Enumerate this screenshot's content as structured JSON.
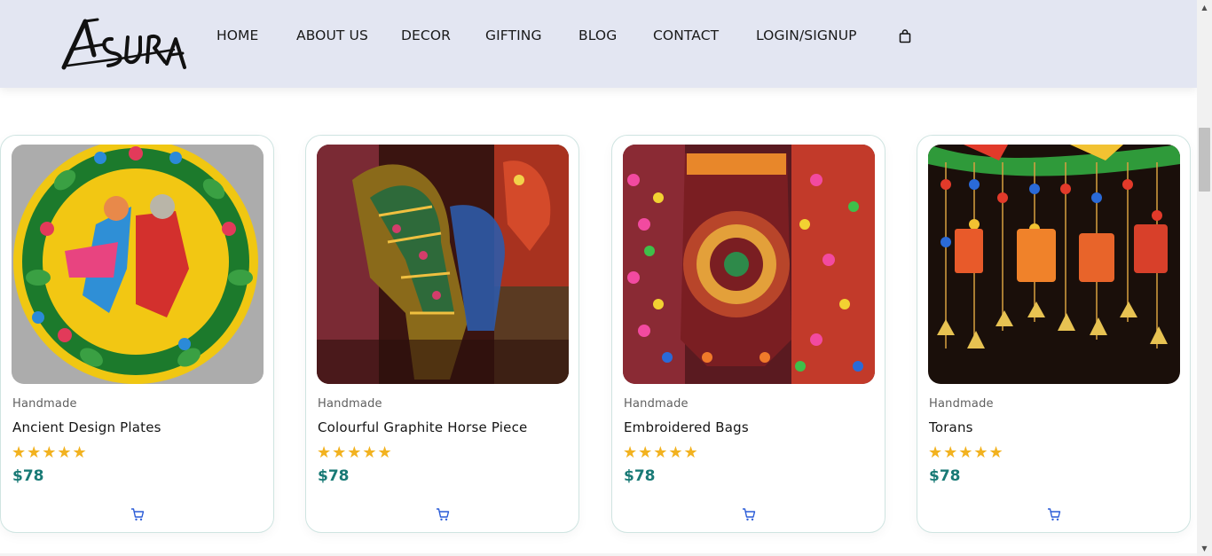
{
  "brand": {
    "logo_text": "Asura"
  },
  "nav": {
    "items": [
      "HOME",
      "ABOUT US",
      "DECOR",
      "GIFTING",
      "BLOG",
      "CONTACT",
      "LOGIN/SIGNUP"
    ],
    "cart_icon": "shopping-bag-icon"
  },
  "colors": {
    "header_bg": "#e3e6f2",
    "price": "#197a76",
    "star": "#f2b21f",
    "card_border": "#cfe4e1",
    "cart_icon": "#2a5bd7"
  },
  "products": [
    {
      "category": "Handmade",
      "title": "Ancient Design Plates",
      "rating": "★★★★★",
      "price": "$78",
      "image_icon": "painted-plate-image",
      "cart_icon": "cart-icon"
    },
    {
      "category": "Handmade",
      "title": "Colourful Graphite Horse Piece",
      "rating": "★★★★★",
      "price": "$78",
      "image_icon": "painted-horse-image",
      "cart_icon": "cart-icon"
    },
    {
      "category": "Handmade",
      "title": "Embroidered Bags",
      "rating": "★★★★★",
      "price": "$78",
      "image_icon": "embroidered-bag-image",
      "cart_icon": "cart-icon"
    },
    {
      "category": "Handmade",
      "title": "Torans",
      "rating": "★★★★★",
      "price": "$78",
      "image_icon": "toran-image",
      "cart_icon": "cart-icon"
    }
  ]
}
